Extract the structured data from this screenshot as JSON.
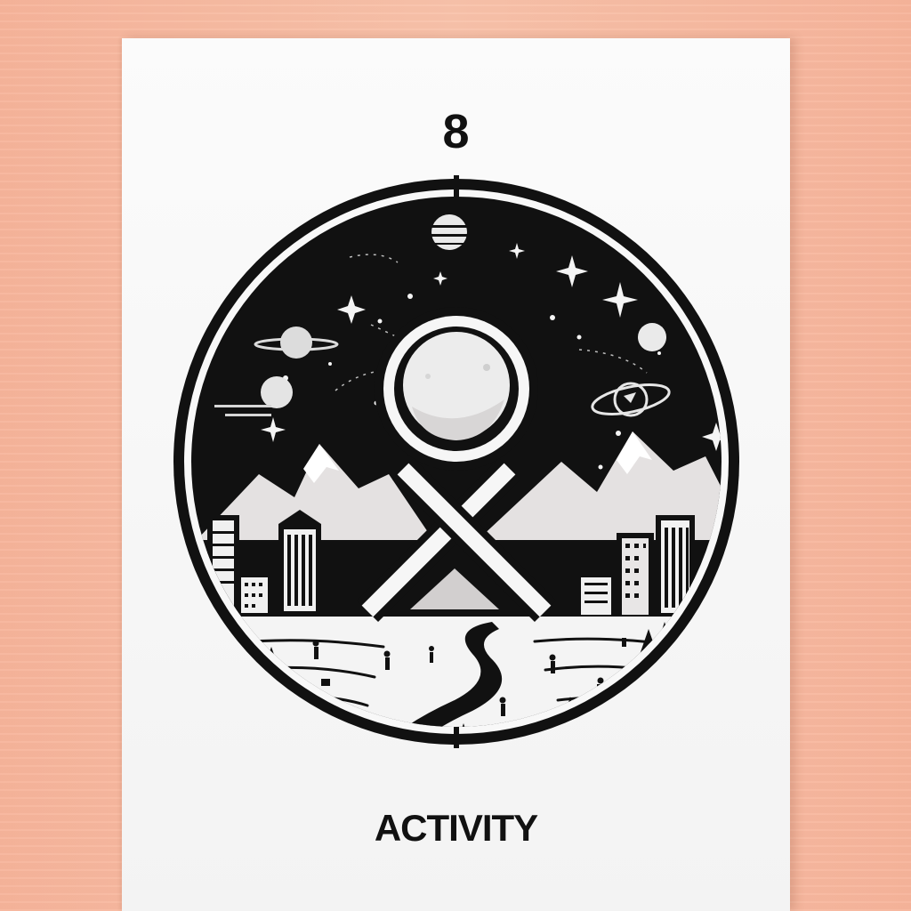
{
  "card": {
    "number": "8",
    "label": "ACTIVITY"
  },
  "emblem": {
    "icon": "night-sky-mountain-city-landscape-with-ribbon-loop",
    "colors": {
      "ink": "#111111",
      "paper": "#f8f8f8",
      "snow": "#e4e1e1",
      "background": "#f8bca4"
    }
  }
}
